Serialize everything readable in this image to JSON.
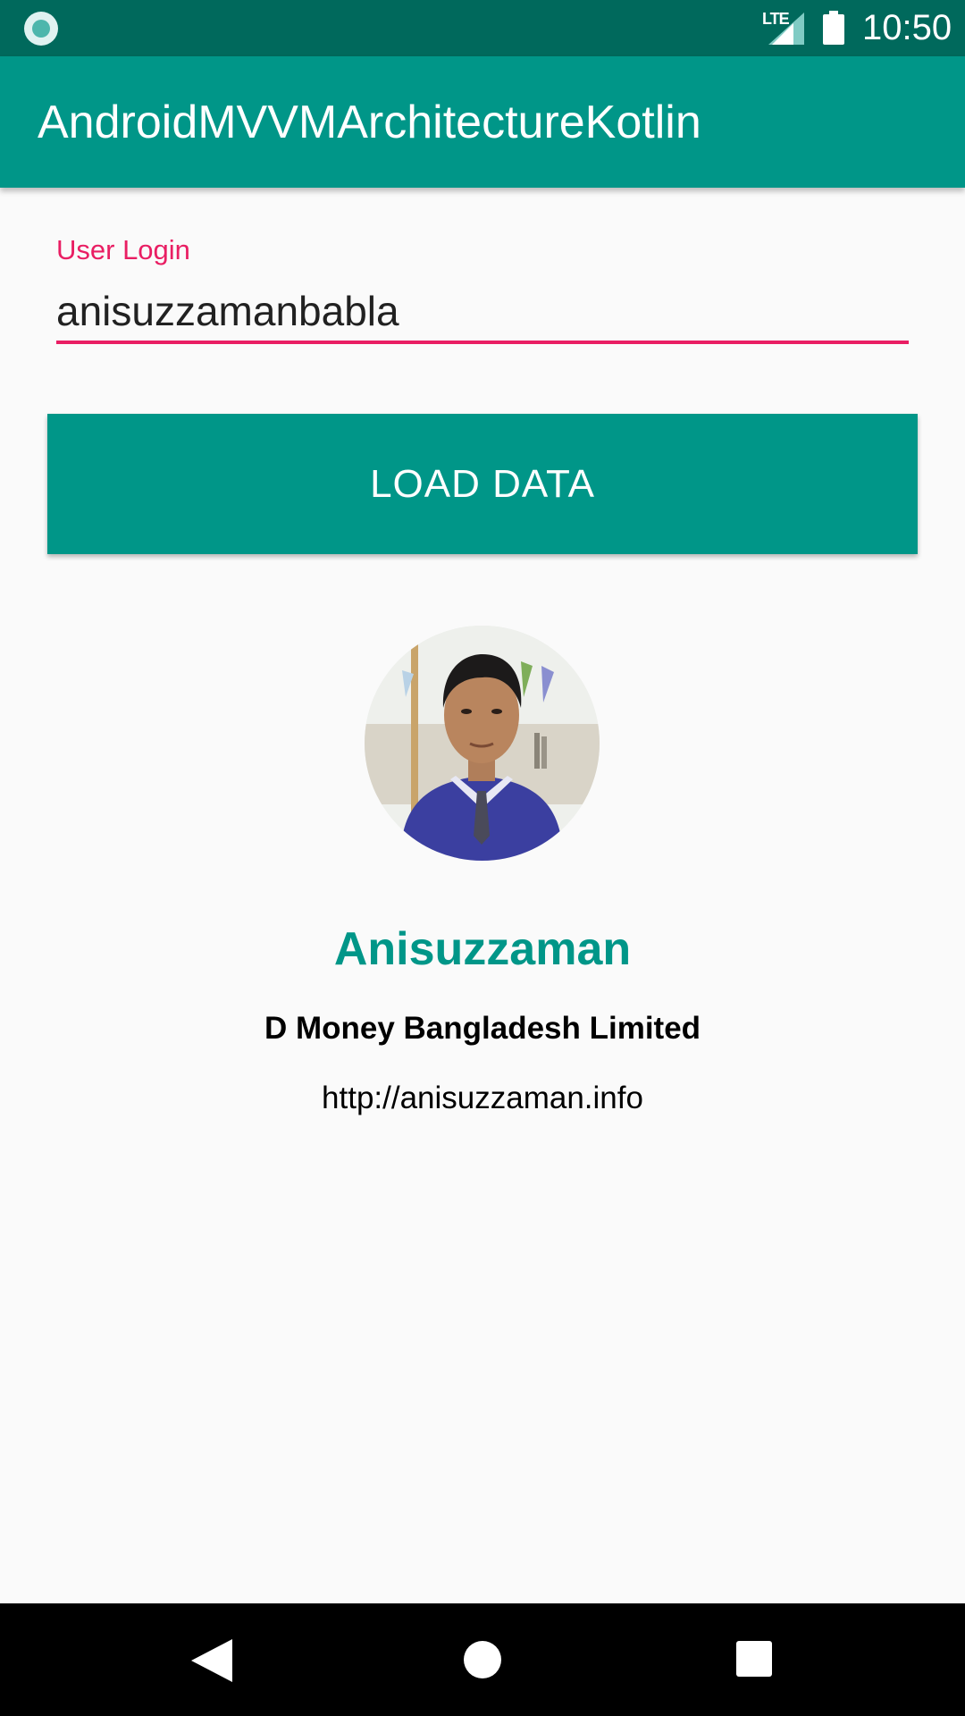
{
  "status_bar": {
    "network_label": "LTE",
    "time": "10:50",
    "icons": [
      "record-icon",
      "signal-icon",
      "battery-icon"
    ]
  },
  "app_bar": {
    "title": "AndroidMVVMArchitectureKotlin"
  },
  "login_form": {
    "label": "User Login",
    "value": "anisuzzamanbabla"
  },
  "load_button": {
    "label": "LOAD DATA"
  },
  "user": {
    "name": "Anisuzzaman",
    "company": "D Money Bangladesh Limited",
    "blog": "http://anisuzzaman.info"
  },
  "nav_bar": {
    "icons": [
      "back-icon",
      "home-icon",
      "recents-icon"
    ]
  },
  "colors": {
    "primary": "#009688",
    "primary_dark": "#00695c",
    "accent": "#e91e63",
    "background": "#fafafa"
  }
}
